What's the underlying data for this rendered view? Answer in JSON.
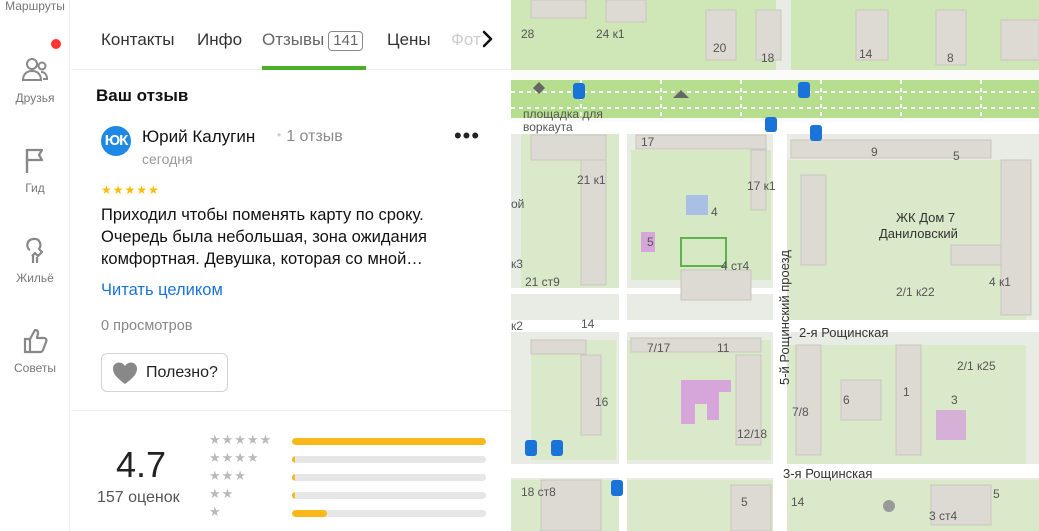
{
  "rail": {
    "top_label": "Маршруты",
    "items": [
      {
        "label": "Друзья",
        "icon": "friends-icon"
      },
      {
        "label": "Гид",
        "icon": "flag-icon"
      },
      {
        "label": "Жильё",
        "icon": "housing-icon"
      },
      {
        "label": "Советы",
        "icon": "thumb-up-icon"
      }
    ]
  },
  "tabs": {
    "items": [
      "Контакты",
      "Инфо",
      "Отзывы",
      "Цены",
      "Фото"
    ],
    "reviews_count": "141",
    "active": "Отзывы"
  },
  "review": {
    "section_title": "Ваш отзыв",
    "avatar_initials": "ЮК",
    "author": "Юрий Калугин",
    "author_reviews": "1 отзыв",
    "date": "сегодня",
    "more": "•••",
    "stars": "★★★★★",
    "rating": 5,
    "text": "Приходил чтобы поменять карту по сроку. Очередь была небольшая, зона ожидания комфортная. Девушка, которая со мной…",
    "read_more": "Читать целиком",
    "views": "0 просмотров",
    "helpful": "Полезно?"
  },
  "summary": {
    "rating": "4.7",
    "count": "157 оценок",
    "distribution": [
      {
        "stars": "★★★★★",
        "fraction": 1.0
      },
      {
        "stars": "★★★★",
        "fraction": 0.01
      },
      {
        "stars": "★★★",
        "fraction": 0.01
      },
      {
        "stars": "★★",
        "fraction": 0.01
      },
      {
        "stars": "★",
        "fraction": 0.18
      }
    ]
  },
  "map": {
    "labels": [
      "28",
      "24 к1",
      "20",
      "18",
      "14",
      "8",
      "17",
      "21 к1",
      "17 к1",
      "9",
      "5",
      "4",
      "5",
      "4 ст4",
      "ЖК Дом 7",
      "Даниловский",
      "2/1 к22",
      "4 к1",
      "21 ст9",
      "к3",
      "к2",
      "14",
      "7/17",
      "11",
      "2/1 к25",
      "16",
      "7/8",
      "12/18",
      "6",
      "1",
      "3",
      "18 ст8",
      "5",
      "14",
      "3 ст4",
      "5",
      "ой",
      "площадка для",
      "воркаута"
    ],
    "streets": [
      "5-й Рощинский проезд",
      "2-я Рощинская",
      "3-я Рощинская"
    ]
  },
  "colors": {
    "accent_green": "#4caf2a",
    "link_blue": "#1a73d8",
    "star_yellow": "#fbbc05",
    "bar_yellow": "#fbb81b",
    "avatar_blue": "#1e88e5",
    "notification_red": "#ff3333"
  }
}
